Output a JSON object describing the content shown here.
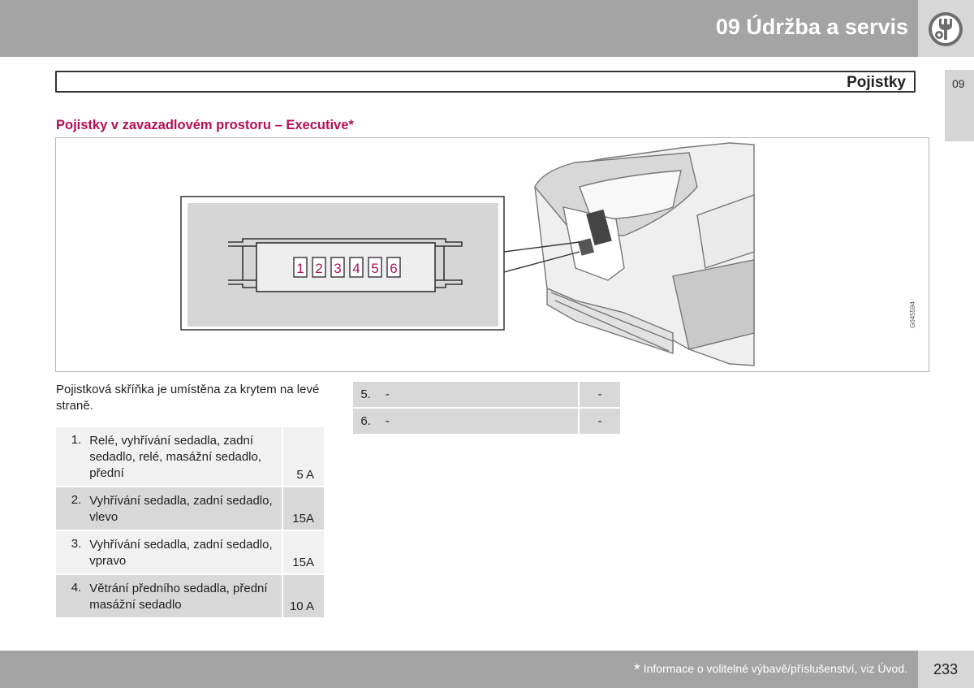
{
  "header": {
    "chapter_title": "09 Údržba a servis"
  },
  "section": {
    "title": "Pojistky"
  },
  "side_tab": {
    "label": "09"
  },
  "subheading": "Pojistky v zavazadlovém prostoru – Executive*",
  "figure": {
    "fuse_labels": [
      "1",
      "2",
      "3",
      "4",
      "5",
      "6"
    ],
    "image_code": "G045594",
    "label_color": "#b40f55"
  },
  "intro_text": "Pojistková skříňka je umístěna za krytem na levé straně.",
  "fuses_left": [
    {
      "num": "1.",
      "desc": "Relé, vyhřívání sedadla, zadní sedadlo, relé, masážní sedadlo, přední",
      "amp": "5 A"
    },
    {
      "num": "2.",
      "desc": "Vyhřívání sedadla, zadní sedadlo, vlevo",
      "amp": "15A"
    },
    {
      "num": "3.",
      "desc": "Vyhřívání sedadla, zadní sedadlo, vpravo",
      "amp": "15A"
    },
    {
      "num": "4.",
      "desc": "Větrání předního sedadla, přední masážní sedadlo",
      "amp": "10 A"
    }
  ],
  "fuses_right": [
    {
      "num": "5.",
      "desc": "-",
      "amp": "-"
    },
    {
      "num": "6.",
      "desc": "-",
      "amp": "-"
    }
  ],
  "footer": {
    "star": "*",
    "note": "Informace o volitelné výbavě/příslušenství, viz Úvod.",
    "page_number": "233"
  }
}
